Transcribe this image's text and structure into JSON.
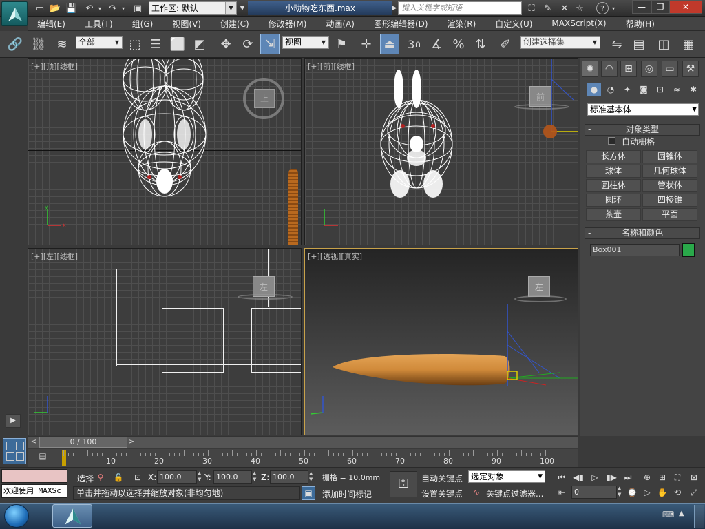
{
  "title_bar": {
    "workspace_label": "工作区: 默认",
    "document_title": "小动物吃东西.max",
    "search_placeholder": "键入关键字或短语"
  },
  "menu": [
    "编辑(E)",
    "工具(T)",
    "组(G)",
    "视图(V)",
    "创建(C)",
    "修改器(M)",
    "动画(A)",
    "图形编辑器(D)",
    "渲染(R)",
    "自定义(U)",
    "MAXScript(X)",
    "帮助(H)"
  ],
  "toolbar": {
    "selection_filter": "全部",
    "reference_coord": "视图",
    "snap_label": "3",
    "named_selection_placeholder": "创建选择集"
  },
  "viewports": {
    "top": {
      "plus": "[+]",
      "name": "[顶]",
      "mode": "[线框]",
      "cube_label": "上"
    },
    "front": {
      "plus": "[+]",
      "name": "[前]",
      "mode": "[线框]",
      "cube_label": "前"
    },
    "left": {
      "plus": "[+]",
      "name": "[左]",
      "mode": "[线框]",
      "cube_label": "左"
    },
    "persp": {
      "plus": "[+]",
      "name": "[透视]",
      "mode": "[真实]",
      "cube_label": "左"
    }
  },
  "command_panel": {
    "category": "标准基本体",
    "object_type_title": "对象类型",
    "autogrid_label": "自动栅格",
    "autogrid_checked": false,
    "buttons": [
      "长方体",
      "圆锥体",
      "球体",
      "几何球体",
      "圆柱体",
      "管状体",
      "圆环",
      "四棱锥",
      "茶壶",
      "平面"
    ],
    "name_color_title": "名称和颜色",
    "object_name": "Box001",
    "object_color": "#2aa84a"
  },
  "timeline": {
    "frame_display": "0 / 100",
    "current_frame": 0,
    "total_frames": 100,
    "tick_labels": [
      "10",
      "20",
      "30",
      "40",
      "50",
      "60",
      "70",
      "80",
      "90",
      "100"
    ]
  },
  "status": {
    "maxscript_label": "欢迎使用 MAXSc",
    "selection_label": "选择",
    "x_label": "X:",
    "x_value": "100.0",
    "y_label": "Y:",
    "y_value": "100.0",
    "z_label": "Z:",
    "z_value": "100.0",
    "grid_label": "栅格 = 10.0mm",
    "prompt_text": "单击并拖动以选择并缩放对象(非均匀地)",
    "add_time_tag": "添加时间标记",
    "auto_key": "自动关键点",
    "set_key": "设置关键点",
    "key_mode_select": "选定对象",
    "key_filters": "关键点过滤器...",
    "frame_field": "0"
  },
  "colors": {
    "accent": "#5e86b6",
    "carrot": "#d08a3a",
    "wire": "#ffffff",
    "object_color": "#2aa84a"
  }
}
